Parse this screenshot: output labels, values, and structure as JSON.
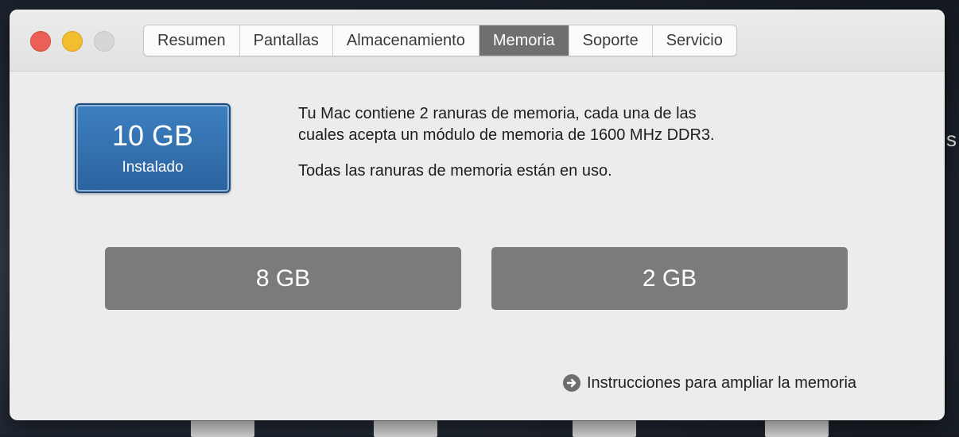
{
  "tabs": [
    {
      "label": "Resumen",
      "active": false
    },
    {
      "label": "Pantallas",
      "active": false
    },
    {
      "label": "Almacenamiento",
      "active": false
    },
    {
      "label": "Memoria",
      "active": true
    },
    {
      "label": "Soporte",
      "active": false
    },
    {
      "label": "Servicio",
      "active": false
    }
  ],
  "memory": {
    "total": "10 GB",
    "total_label": "Instalado",
    "description_line1": "Tu Mac contiene 2 ranuras de memoria, cada una de las",
    "description_line2": "cuales acepta un módulo de memoria de 1600 MHz DDR3.",
    "status": "Todas las ranuras de memoria están en uso.",
    "slots": [
      "8 GB",
      "2 GB"
    ]
  },
  "upgrade_link": "Instrucciones para ampliar la memoria",
  "colors": {
    "close": "#ec5f56",
    "minimize": "#f3bd30",
    "badge": "#3572b0",
    "active_tab": "#6f6f6f",
    "slot": "#7b7b7b"
  },
  "icons": {
    "link_icon": "arrow-circle-right-icon"
  }
}
